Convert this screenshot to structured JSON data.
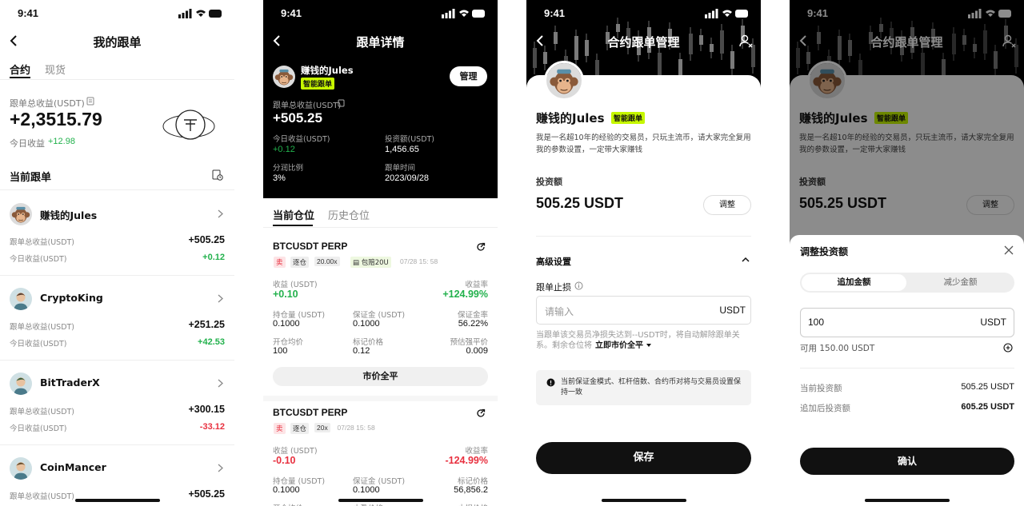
{
  "status_time": "9:41",
  "s1": {
    "title": "我的跟单",
    "tabs": [
      "合约",
      "现货"
    ],
    "total_label": "跟单总收益(USDT)",
    "total_value": "+2,3515.79",
    "today_label": "今日收益",
    "today_value": "+12.98",
    "section_title": "当前跟单",
    "rows": [
      {
        "name": "赚钱的Jules",
        "l1": "跟单总收益(USDT)",
        "v1": "+505.25",
        "l2": "今日收益(USDT)",
        "v2": "+0.12",
        "v2_color": "green"
      },
      {
        "name": "CryptoKing",
        "l1": "跟单总收益(USDT)",
        "v1": "+251.25",
        "l2": "今日收益(USDT)",
        "v2": "+42.53",
        "v2_color": "green"
      },
      {
        "name": "BitTraderX",
        "l1": "跟单总收益(USDT)",
        "v1": "+300.15",
        "l2": "今日收益(USDT)",
        "v2": "-33.12",
        "v2_color": "red"
      },
      {
        "name": "CoinMancer",
        "l1": "跟单总收益(USDT)",
        "v1": "+505.25",
        "l2": "",
        "v2": "",
        "v2_color": "green"
      }
    ]
  },
  "s2": {
    "title": "跟单详情",
    "trader_name": "赚钱的Jules",
    "trader_tag": "智能跟单",
    "manage_label": "管理",
    "total_label": "跟单总收益(USDT)",
    "total_value": "+505.25",
    "stats": [
      {
        "label": "今日收益(USDT)",
        "value": "+0.12",
        "color": "green"
      },
      {
        "label": "投资额(USDT)",
        "value": "1,456.65",
        "color": "white"
      },
      {
        "label": "分润比例",
        "value": "3%",
        "color": "white"
      },
      {
        "label": "跟单时间",
        "value": "2023/09/28",
        "color": "white"
      }
    ],
    "tabs": [
      "当前仓位",
      "历史仓位"
    ],
    "positions": [
      {
        "symbol": "BTCUSDT PERP",
        "side": "卖",
        "mode": "逐仓",
        "lev": "20.00x",
        "extra": "包赔20U",
        "time": "07/28 15: 58",
        "pnl_label": "收益 (USDT)",
        "pnl": "+0.10",
        "roe_label": "收益率",
        "roe": "+124.99%",
        "color": "green",
        "grid": [
          [
            "持仓量 (USDT)",
            "0.1000"
          ],
          [
            "保证金 (USDT)",
            "0.1000"
          ],
          [
            "保证金率",
            "56.22%"
          ],
          [
            "开仓均价",
            "100"
          ],
          [
            "标记价格",
            "0.12"
          ],
          [
            "预估强平价",
            "0.009"
          ]
        ],
        "close_label": "市价全平"
      },
      {
        "symbol": "BTCUSDT PERP",
        "side": "卖",
        "mode": "逐仓",
        "lev": "20x",
        "extra": "",
        "time": "07/28 15: 58",
        "pnl_label": "收益 (USDT)",
        "pnl": "-0.10",
        "roe_label": "收益率",
        "roe": "-124.99%",
        "color": "red",
        "grid": [
          [
            "持仓量 (USDT)",
            "0.1000"
          ],
          [
            "保证金 (USDT)",
            "0.1000"
          ],
          [
            "标记价格",
            "56,856.2"
          ],
          [
            "开仓均价",
            ""
          ],
          [
            "止盈价格",
            ""
          ],
          [
            "止损价格",
            ""
          ]
        ],
        "close_label": ""
      }
    ]
  },
  "s3": {
    "title": "合约跟单管理",
    "trader_name": "赚钱的Jules",
    "trader_tag": "智能跟单",
    "bio": "我是一名超10年的经验的交易员，只玩主流币，请大家完全复用我的参数设置，一定带大家赚钱",
    "invest_label": "投资额",
    "invest_value": "505.25 USDT",
    "adjust_label": "调整",
    "advanced_label": "高级设置",
    "stop_label": "跟单止损",
    "stop_placeholder": "请输入",
    "stop_unit": "USDT",
    "stop_hint": "当跟单该交易员净损失达到--USDT时，将自动解除跟单关系。剩余仓位将",
    "stop_action": "立即市价全平",
    "notice": "当前保证金模式、杠杆倍数、合约币对将与交易员设置保持一致",
    "save_label": "保存"
  },
  "s4": {
    "title": "合约跟单管理",
    "trader_name": "赚钱的Jules",
    "trader_tag": "智能跟单",
    "bio": "我是一名超10年的经验的交易员，只玩主流币，请大家完全复用我的参数设置，一定带大家赚钱",
    "invest_label": "投资额",
    "invest_value": "505.25 USDT",
    "adjust_label": "调整",
    "sheet_title": "调整投资额",
    "seg": [
      "追加金额",
      "减少金额"
    ],
    "amount": "100",
    "amount_unit": "USDT",
    "available": "可用 150.00 USDT",
    "current_label": "当前投资额",
    "current_value": "505.25 USDT",
    "after_label": "追加后投资额",
    "after_value": "605.25 USDT",
    "confirm_label": "确认"
  }
}
